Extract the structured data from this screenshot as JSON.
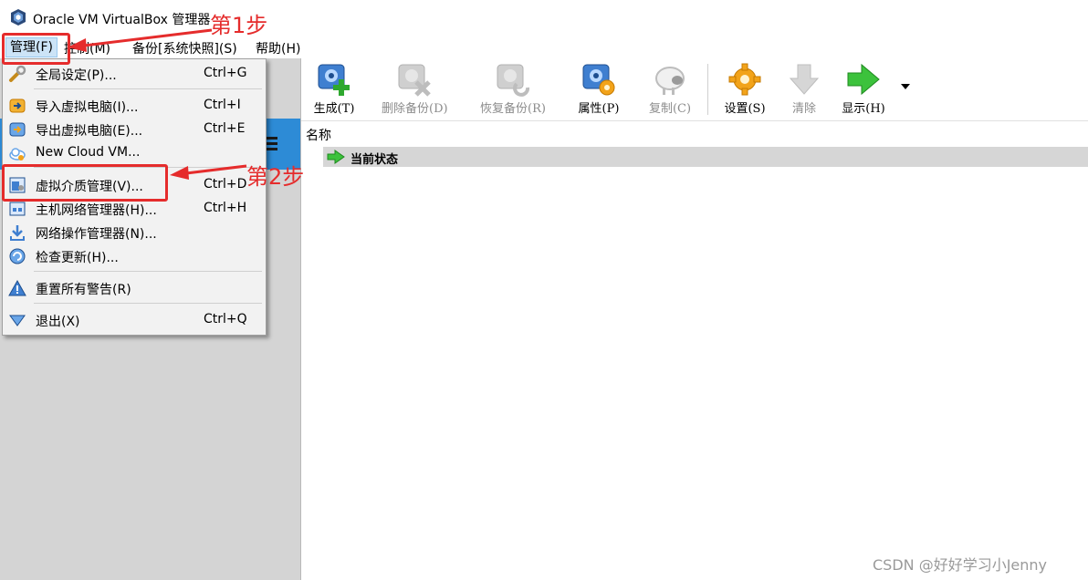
{
  "window": {
    "title": "Oracle VM VirtualBox 管理器"
  },
  "menubar": {
    "items": [
      {
        "label": "管理(F)"
      },
      {
        "label": "控制(M)"
      },
      {
        "label": "备份[系统快照](S)"
      },
      {
        "label": "帮助(H)"
      }
    ]
  },
  "file_menu": {
    "items": [
      {
        "label": "全局设定(P)...",
        "shortcut": "Ctrl+G",
        "icon": "wrench-icon"
      },
      {
        "label": "导入虚拟电脑(I)...",
        "shortcut": "Ctrl+I",
        "icon": "import-icon"
      },
      {
        "label": "导出虚拟电脑(E)...",
        "shortcut": "Ctrl+E",
        "icon": "export-icon"
      },
      {
        "label": "New Cloud VM...",
        "shortcut": "",
        "icon": "cloud-icon"
      },
      {
        "label": "虚拟介质管理(V)...",
        "shortcut": "Ctrl+D",
        "icon": "media-manager-icon"
      },
      {
        "label": "主机网络管理器(H)...",
        "shortcut": "Ctrl+H",
        "icon": "host-network-icon"
      },
      {
        "label": "网络操作管理器(N)...",
        "shortcut": "",
        "icon": "download-icon"
      },
      {
        "label": "检查更新(H)...",
        "shortcut": "",
        "icon": "refresh-icon"
      },
      {
        "label": "重置所有警告(R)",
        "shortcut": "",
        "icon": "warning-icon"
      },
      {
        "label": "退出(X)",
        "shortcut": "Ctrl+Q",
        "icon": "exit-icon"
      }
    ]
  },
  "toolbar": {
    "take": {
      "label": "生成(T)",
      "enabled": true,
      "icon": "take-snapshot-icon"
    },
    "delete": {
      "label": "删除备份(D)",
      "enabled": false,
      "icon": "delete-snapshot-icon"
    },
    "restore": {
      "label": "恢复备份(R)",
      "enabled": false,
      "icon": "restore-snapshot-icon"
    },
    "properties": {
      "label": "属性(P)",
      "enabled": true,
      "icon": "properties-icon"
    },
    "clone": {
      "label": "复制(C)",
      "enabled": false,
      "icon": "clone-sheep-icon"
    },
    "settings": {
      "label": "设置(S)",
      "enabled": true,
      "icon": "settings-gear-icon"
    },
    "discard": {
      "label": "清除",
      "enabled": false,
      "icon": "discard-arrow-icon"
    },
    "show": {
      "label": "显示(H)",
      "enabled": true,
      "icon": "show-arrow-icon"
    }
  },
  "snapshot_pane": {
    "column_header": "名称",
    "current_state": "当前状态"
  },
  "annotations": {
    "step1": "第1步",
    "step2": "第2步",
    "color": "#e52c2c"
  },
  "watermark": "CSDN @好好学习小Jenny"
}
